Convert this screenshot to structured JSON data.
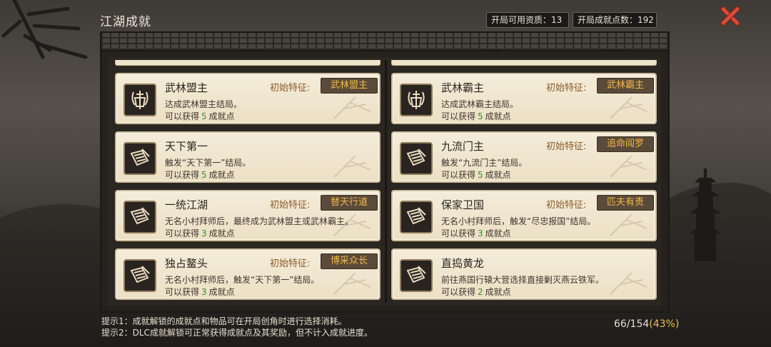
{
  "title": "江湖成就",
  "stats": {
    "available_label": "开局可用资质：",
    "available_value": "13",
    "points_label": "开局成就点数：",
    "points_value": "192"
  },
  "close_icon": "close-x-icon",
  "trait_label": "初始特征:",
  "cards": [
    {
      "icon": "sword-emblem-icon",
      "name": "武林盟主",
      "desc": "达成武林盟主结局。",
      "reward_prefix": "可以获得",
      "reward_num": "5",
      "reward_suffix": "成就点",
      "trait": "武林盟主",
      "has_trait": true
    },
    {
      "icon": "sword-emblem-icon",
      "name": "武林霸主",
      "desc": "达成武林霸主结局。",
      "reward_prefix": "可以获得",
      "reward_num": "5",
      "reward_suffix": "成就点",
      "trait": "武林霸主",
      "has_trait": true
    },
    {
      "icon": "scroll-icon",
      "name": "天下第一",
      "desc": "触发“天下第一”结局。",
      "reward_prefix": "可以获得",
      "reward_num": "5",
      "reward_suffix": "成就点",
      "trait": "",
      "has_trait": false
    },
    {
      "icon": "scroll-icon",
      "name": "九流门主",
      "desc": "触发“九流门主”结局。",
      "reward_prefix": "可以获得",
      "reward_num": "5",
      "reward_suffix": "成就点",
      "trait": "追命阎罗",
      "has_trait": true
    },
    {
      "icon": "scroll-icon",
      "name": "一统江湖",
      "desc": "无名小村拜师后，最终成为武林盟主或武林霸主。",
      "reward_prefix": "可以获得",
      "reward_num": "3",
      "reward_suffix": "成就点",
      "trait": "替天行道",
      "has_trait": true
    },
    {
      "icon": "scroll-icon",
      "name": "保家卫国",
      "desc": "无名小村拜师后，触发“尽忠报国”结局。",
      "reward_prefix": "可以获得",
      "reward_num": "3",
      "reward_suffix": "成就点",
      "trait": "匹夫有责",
      "has_trait": true
    },
    {
      "icon": "scroll-icon",
      "name": "独占鳌头",
      "desc": "无名小村拜师后，触发“天下第一”结局。",
      "reward_prefix": "可以获得",
      "reward_num": "3",
      "reward_suffix": "成就点",
      "trait": "博采众长",
      "has_trait": true
    },
    {
      "icon": "scroll-icon",
      "name": "直捣黄龙",
      "desc": "前往燕国行辕大营选择直接剿灭燕云铁军。",
      "reward_prefix": "可以获得",
      "reward_num": "2",
      "reward_suffix": "成就点",
      "trait": "",
      "has_trait": false
    }
  ],
  "tips": {
    "tip1": "提示1：成就解锁的成就点和物品可在开局创角时进行选择消耗。",
    "tip2": "提示2：DLC成就解锁可正常获得成就点及其奖励，但不计入成就进度。"
  },
  "progress": {
    "count": "66/154",
    "percent": "(43%)"
  },
  "colors": {
    "trait_text": "#f2b84a",
    "reward_number": "#3d8a2f",
    "close": "#d94b3c"
  }
}
